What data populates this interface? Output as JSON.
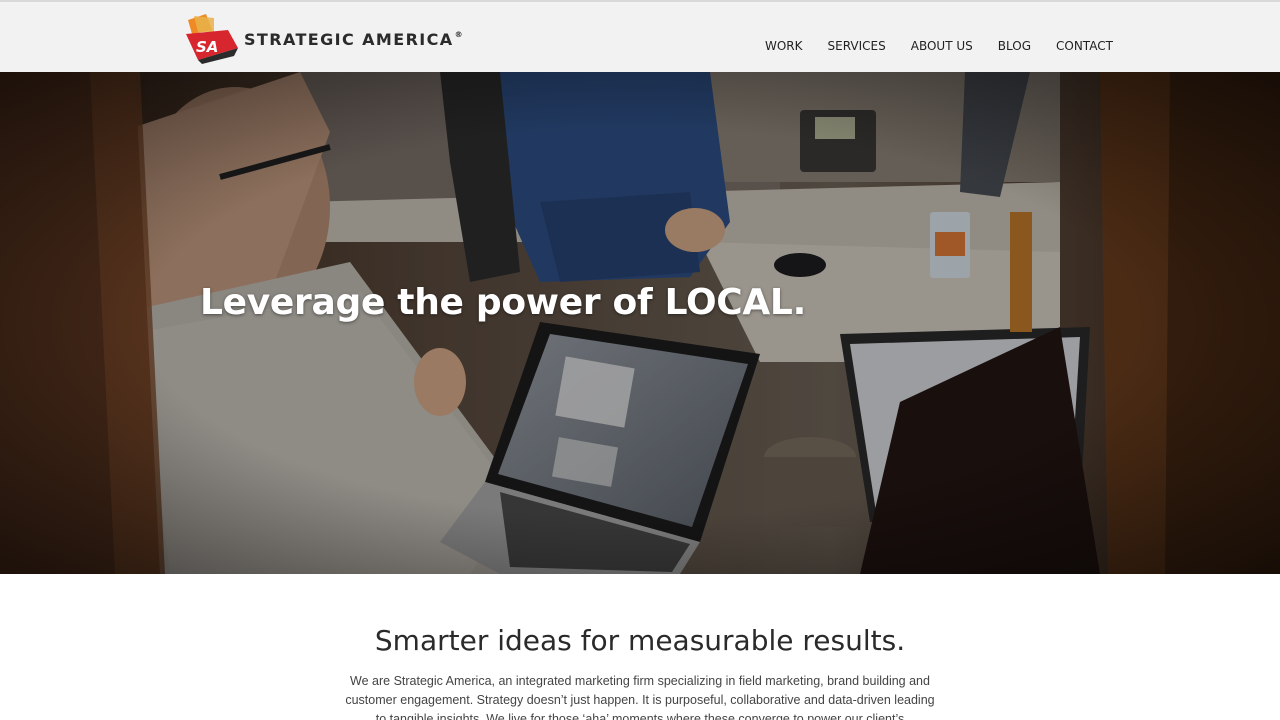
{
  "brand": {
    "mark_text": "SA",
    "name": "STRATEGIC AMERICA",
    "reg": "®",
    "colors": {
      "red": "#d7262e",
      "orange": "#f08a24",
      "dark": "#2b2b2b"
    }
  },
  "nav": {
    "items": [
      {
        "label": "WORK"
      },
      {
        "label": "SERVICES"
      },
      {
        "label": "ABOUT US"
      },
      {
        "label": "BLOG"
      },
      {
        "label": "CONTACT"
      }
    ]
  },
  "hero": {
    "headline_lead": "Leverage the power of ",
    "headline_strong": "LOCAL."
  },
  "intro": {
    "heading": "Smarter ideas for measurable results.",
    "body": "We are Strategic America, an integrated marketing firm specializing in field marketing, brand building and customer engagement. Strategy doesn’t just happen. It is purposeful, collaborative and data-driven leading to tangible insights. We live for those ‘aha’ moments where these converge to power our client’s"
  }
}
